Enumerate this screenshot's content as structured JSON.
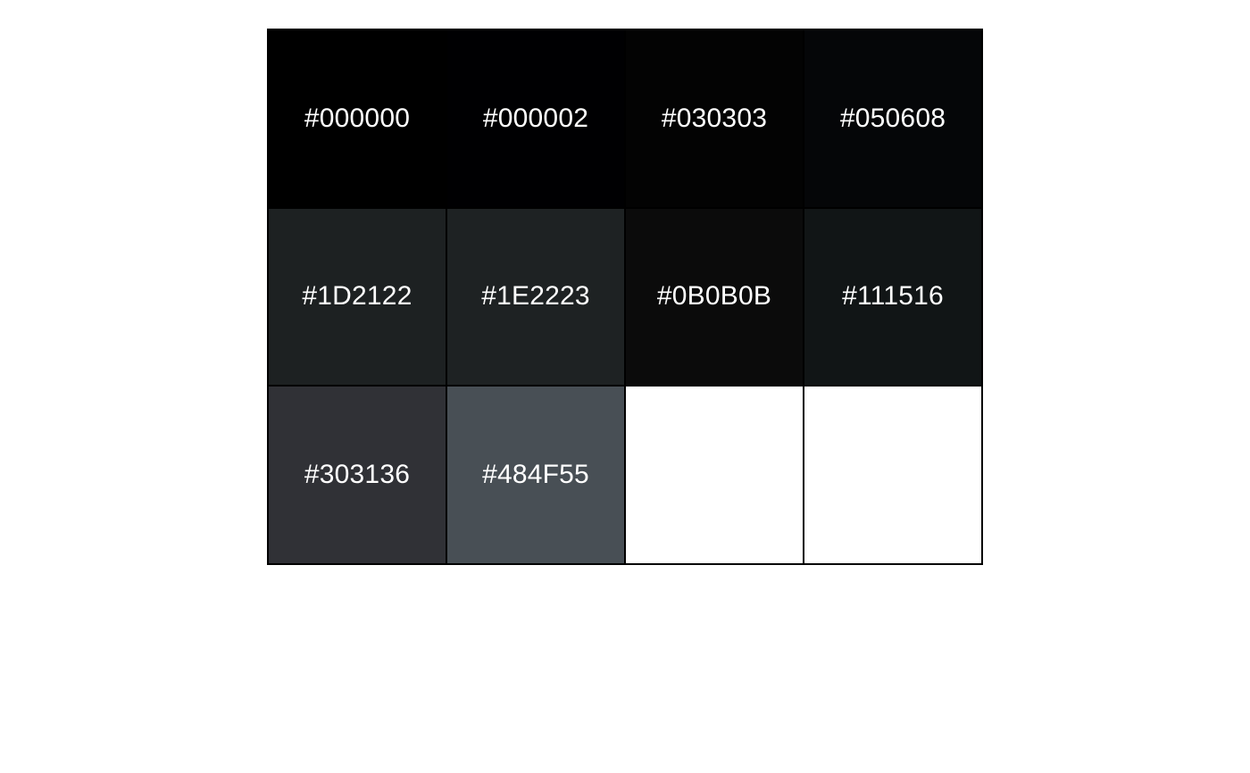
{
  "palette": {
    "swatches": [
      {
        "hex": "#000000",
        "label": "#000000"
      },
      {
        "hex": "#000002",
        "label": "#000002"
      },
      {
        "hex": "#030303",
        "label": "#030303"
      },
      {
        "hex": "#050608",
        "label": "#050608"
      },
      {
        "hex": "#1D2122",
        "label": "#1D2122"
      },
      {
        "hex": "#1E2223",
        "label": "#1E2223"
      },
      {
        "hex": "#0B0B0B",
        "label": "#0B0B0B"
      },
      {
        "hex": "#111516",
        "label": "#111516"
      },
      {
        "hex": "#303136",
        "label": "#303136"
      },
      {
        "hex": "#484F55",
        "label": "#484F55"
      },
      {
        "hex": "#FFFFFF",
        "label": ""
      },
      {
        "hex": "#FFFFFF",
        "label": ""
      }
    ]
  }
}
